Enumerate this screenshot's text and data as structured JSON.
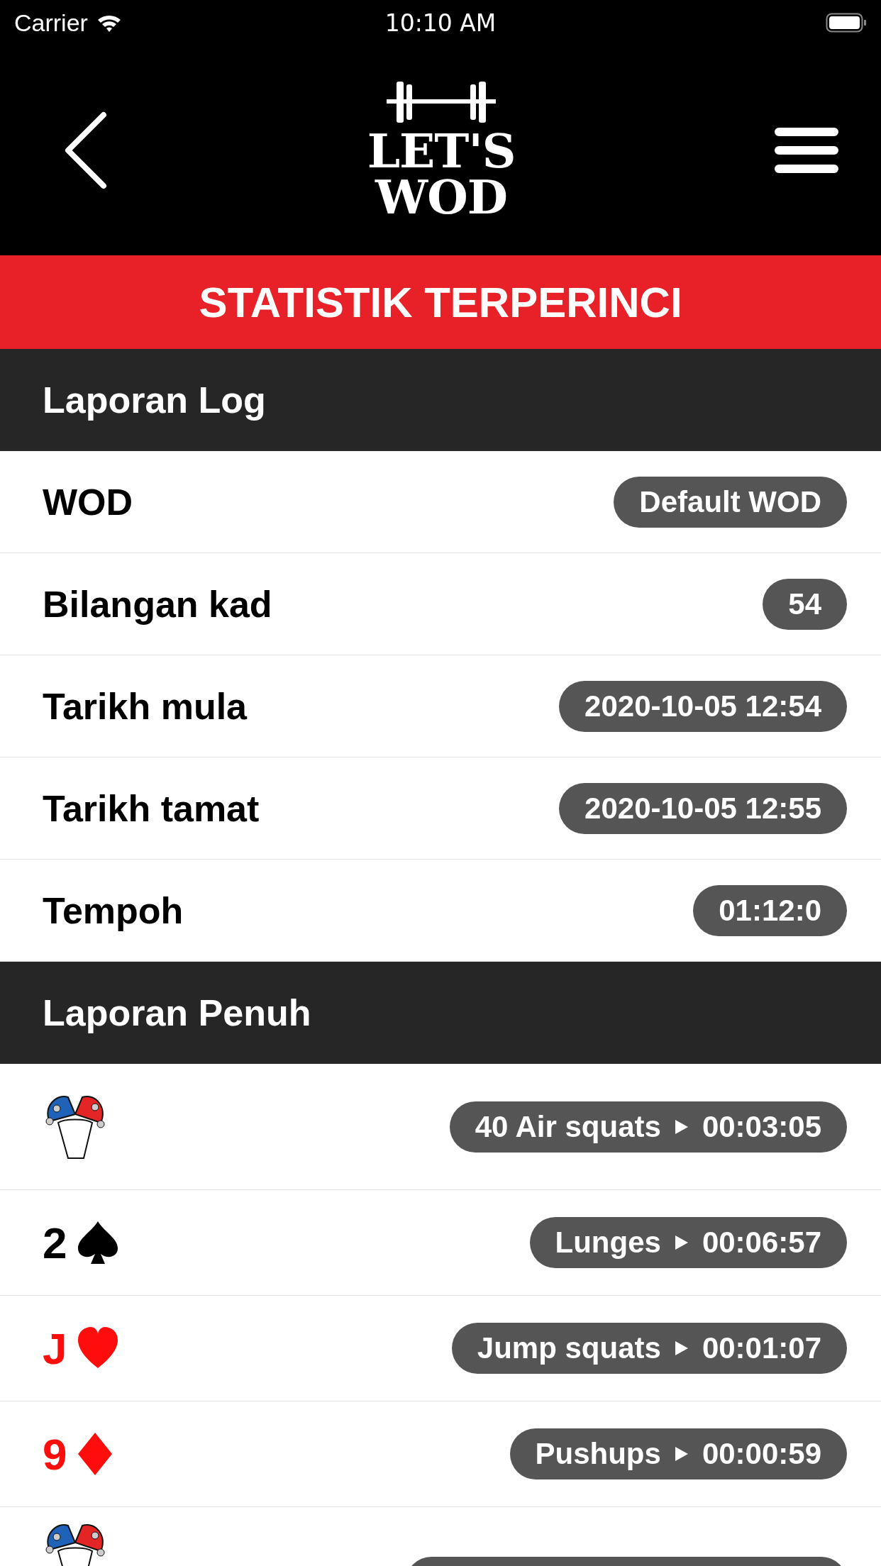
{
  "status_bar": {
    "carrier": "Carrier",
    "time": "10:10 AM"
  },
  "header": {
    "logo_line_1": "LET'S",
    "logo_line_2": "WOD"
  },
  "title": "STATISTIK TERPERINCI",
  "sections": [
    {
      "title": "Laporan Log",
      "rows": [
        {
          "kind": "info",
          "label": "WOD",
          "value": "Default WOD"
        },
        {
          "kind": "info",
          "label": "Bilangan kad",
          "value": "54"
        },
        {
          "kind": "info",
          "label": "Tarikh mula",
          "value": "2020-10-05 12:54"
        },
        {
          "kind": "info",
          "label": "Tarikh tamat",
          "value": "2020-10-05 12:55"
        },
        {
          "kind": "info",
          "label": "Tempoh",
          "value": "01:12:0"
        }
      ]
    },
    {
      "title": "Laporan Penuh",
      "rows": [
        {
          "kind": "joker",
          "exercise": "40 Air squats",
          "duration": "00:03:05"
        },
        {
          "kind": "card",
          "rank": "2",
          "suit": {
            "kind": "spade"
          },
          "exercise": "Lunges",
          "duration": "00:06:57"
        },
        {
          "kind": "card",
          "rank": "J",
          "suit": {
            "kind": "heart"
          },
          "exercise": "Jump squats",
          "duration": "00:01:07"
        },
        {
          "kind": "card",
          "rank": "9",
          "suit": {
            "kind": "diamond"
          },
          "exercise": "Pushups",
          "duration": "00:00:59"
        },
        {
          "kind": "joker_cut"
        }
      ]
    }
  ]
}
